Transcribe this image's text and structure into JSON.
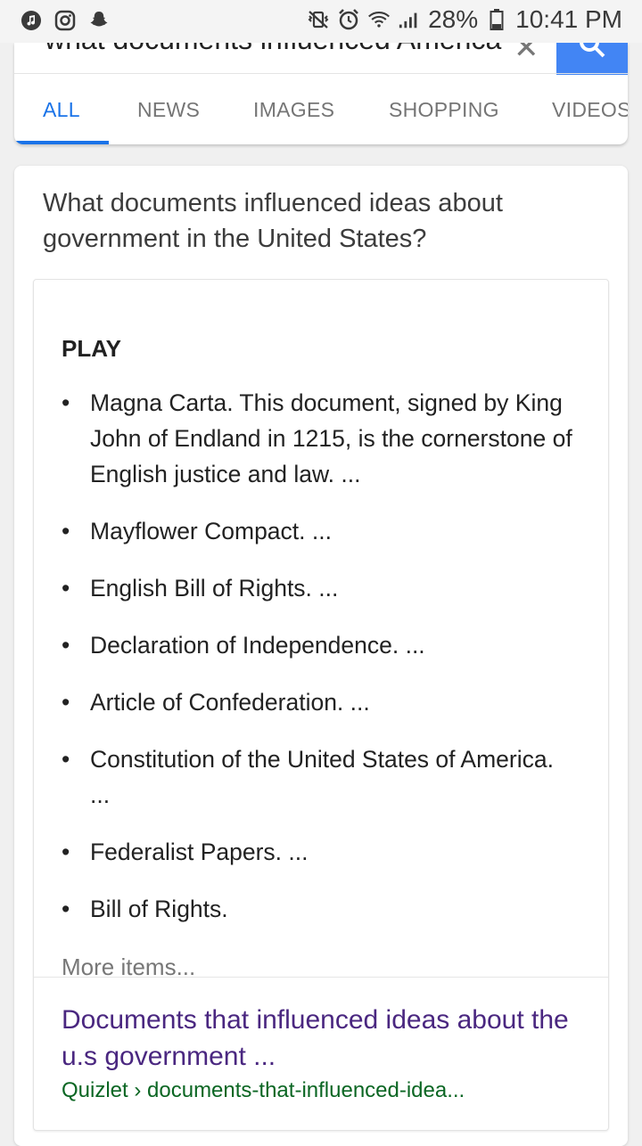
{
  "status_bar": {
    "left_icons": [
      "music-note-icon",
      "instagram-icon",
      "snapchat-icon"
    ],
    "right_icons": [
      "vibrate-icon",
      "alarm-icon",
      "wifi-icon",
      "signal-icon"
    ],
    "battery_percent": "28%",
    "time": "10:41 PM"
  },
  "search": {
    "query": "what documents influenced America",
    "clear_icon": "close-icon",
    "search_icon": "search-icon",
    "accent_color": "#4285f4"
  },
  "tabs": [
    {
      "label": "ALL",
      "active": true
    },
    {
      "label": "NEWS",
      "active": false
    },
    {
      "label": "IMAGES",
      "active": false
    },
    {
      "label": "SHOPPING",
      "active": false
    },
    {
      "label": "VIDEOS",
      "active": false
    }
  ],
  "featured": {
    "question": "What documents influenced ideas about government in the United States?",
    "heading": "PLAY",
    "items": [
      "Magna Carta. This document, signed by King John of Endland in 1215, is the cornerstone of English justice and law. ...",
      "Mayflower Compact. ...",
      "English Bill of Rights. ...",
      "Declaration of Independence. ...",
      "Article of Confederation. ...",
      "Constitution of the United States of America. ...",
      "Federalist Papers. ...",
      "Bill of Rights."
    ],
    "more_items": "More items...",
    "result": {
      "title": "Documents that influenced ideas about the u.s government ...",
      "url": "Quizlet › documents-that-influenced-idea..."
    }
  }
}
